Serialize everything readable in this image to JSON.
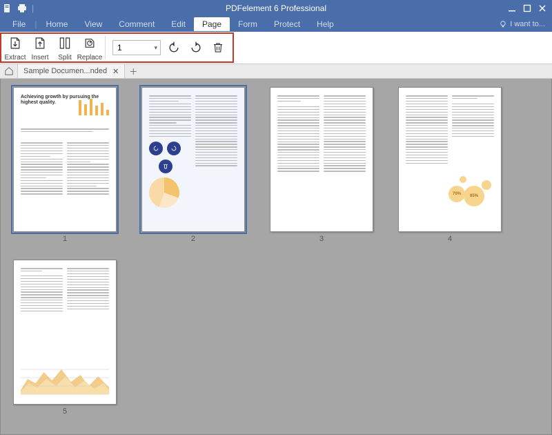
{
  "app": {
    "title": "PDFelement 6 Professional"
  },
  "menu": {
    "items": [
      "File",
      "Home",
      "View",
      "Comment",
      "Edit",
      "Page",
      "Form",
      "Protect",
      "Help"
    ],
    "active_index": 5,
    "i_want_to": "I want to..."
  },
  "ribbon": {
    "extract": "Extract",
    "insert": "Insert",
    "split": "Split",
    "replace": "Replace",
    "page_value": "1"
  },
  "tabs": {
    "doc_title": "Sample Documen...nded"
  },
  "thumbnails": {
    "pages": [
      "1",
      "2",
      "3",
      "4",
      "5"
    ],
    "p1_heading": "Achieving growth by pursuing the highest quality.",
    "bubbles": {
      "a": "70%",
      "b": "85%"
    }
  }
}
